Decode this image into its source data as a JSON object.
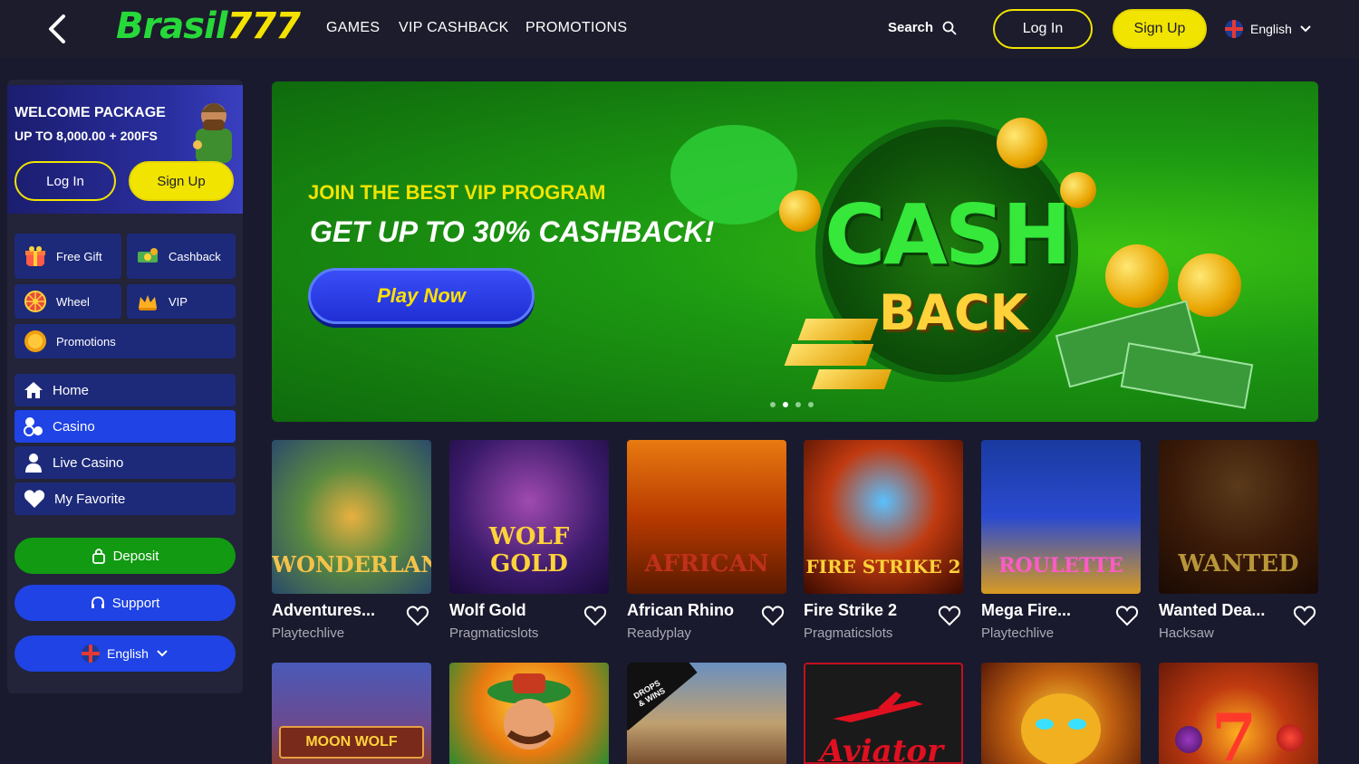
{
  "header": {
    "logo_part1": "Brasil",
    "logo_part2": "777",
    "nav": [
      "GAMES",
      "VIP CASHBACK",
      "PROMOTIONS"
    ],
    "search_label": "Search",
    "login_label": "Log In",
    "signup_label": "Sign Up",
    "language": "English"
  },
  "sidebar": {
    "welcome_title": "WELCOME PACKAGE",
    "welcome_subtitle": "UP TO 8,000.00 + 200FS",
    "login_label": "Log In",
    "signup_label": "Sign Up",
    "quick": [
      {
        "label": "Free Gift",
        "icon": "gift-icon"
      },
      {
        "label": "Cashback",
        "icon": "cashback-icon"
      },
      {
        "label": "Wheel",
        "icon": "wheel-icon"
      },
      {
        "label": "VIP",
        "icon": "vip-crown-icon"
      },
      {
        "label": "Promotions",
        "icon": "promotions-icon"
      }
    ],
    "menu": [
      {
        "label": "Home",
        "icon": "home-icon"
      },
      {
        "label": "Casino",
        "icon": "casino-icon"
      },
      {
        "label": "Live Casino",
        "icon": "live-casino-icon"
      },
      {
        "label": "My Favorite",
        "icon": "heart-icon"
      }
    ],
    "deposit_label": "Deposit",
    "support_label": "Support",
    "language": "English"
  },
  "banner": {
    "kicker": "JOIN THE BEST VIP PROGRAM",
    "headline": "GET UP TO 30% CASHBACK!",
    "cta": "Play Now",
    "art_cash": "CASH",
    "art_back": "BACK",
    "slides": 4,
    "active_slide": 2
  },
  "games": [
    {
      "name": "Adventures...",
      "provider": "Playtechlive",
      "art": "WONDERLAND"
    },
    {
      "name": "Wolf Gold",
      "provider": "Pragmaticslots",
      "art": "WOLF GOLD"
    },
    {
      "name": "African Rhino",
      "provider": "Readyplay",
      "art": "AFRICAN"
    },
    {
      "name": "Fire Strike 2",
      "provider": "Pragmaticslots",
      "art": "FIRE STRIKE 2"
    },
    {
      "name": "Mega Fire...",
      "provider": "Playtechlive",
      "art": "ROULETTE"
    },
    {
      "name": "Wanted Dea...",
      "provider": "Hacksaw",
      "art": "WANTED"
    }
  ],
  "games_row2": [
    {
      "art": "MOON WOLF"
    },
    {
      "art": ""
    },
    {
      "art": "DROPS & WINS"
    },
    {
      "art": "Aviator"
    },
    {
      "art": ""
    },
    {
      "art": ""
    }
  ],
  "colors": {
    "accent_yellow": "#f1e400",
    "primary_blue": "#1f43e4",
    "deposit_green": "#119a12",
    "background": "#1a1a2e"
  }
}
